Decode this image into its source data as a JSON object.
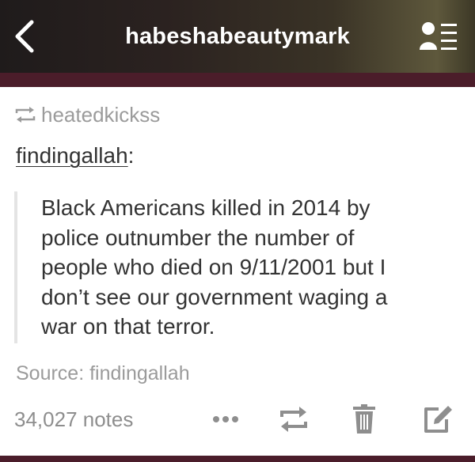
{
  "header": {
    "title": "habeshabeautymark",
    "icons": {
      "back": "chevron-left-icon",
      "profile": "profile-list-icon"
    },
    "strip_color": "#4b1d2a"
  },
  "post": {
    "reblogged_from": "heatedkickss",
    "author": "findingallah",
    "author_suffix": ":",
    "quote_lines": [
      "Black Americans killed in 2014 by",
      "police outnumber the number of",
      "people who died on 9/11/2001 but I",
      "don’t see our government waging a",
      "war on that terror."
    ],
    "source_label": "Source: ",
    "source_name": "findingallah"
  },
  "footer": {
    "notes": "34,027 notes",
    "icons": [
      "more-icon",
      "reblog-icon",
      "trash-icon",
      "edit-icon"
    ],
    "icon_color": "#8e8e8e"
  }
}
